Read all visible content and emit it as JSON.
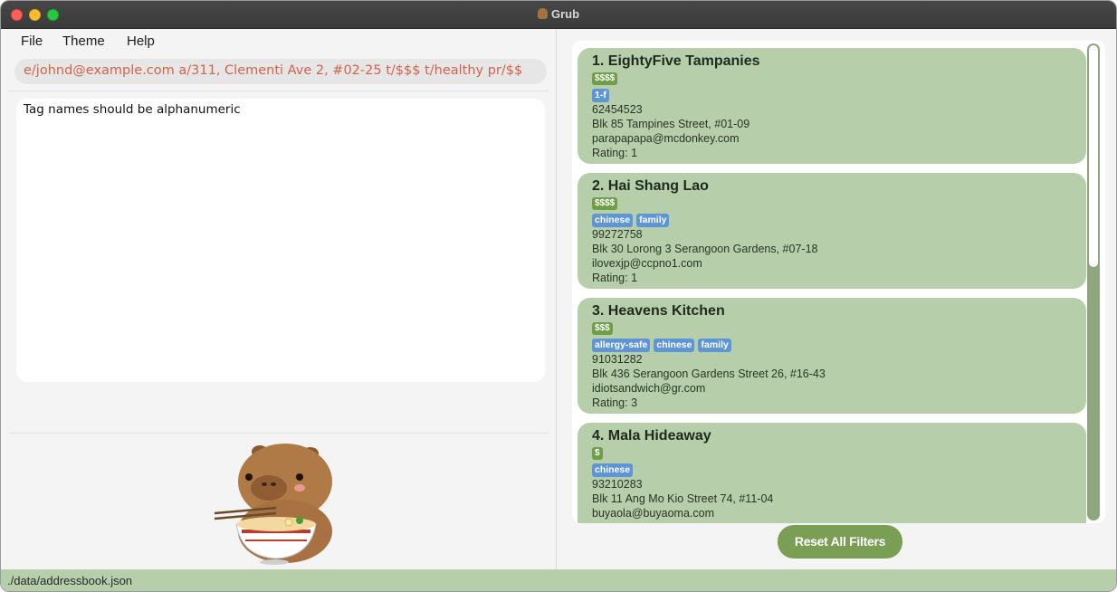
{
  "window": {
    "title": "Grub"
  },
  "menu": {
    "file": "File",
    "theme": "Theme",
    "help": "Help"
  },
  "command": {
    "value": "e/johnd@example.com a/311, Clementi Ave 2, #02-25 t/$$$ t/healthy pr/$$"
  },
  "result": {
    "message": "Tag names should be alphanumeric"
  },
  "restaurants": [
    {
      "name": "1. EightyFive Tampanies",
      "price": "$$$$",
      "tags": [
        "1-f"
      ],
      "phone": "62454523",
      "address": "Blk 85 Tampines Street, #01-09",
      "email": "parapapapa@mcdonkey.com",
      "rating": "Rating:  1"
    },
    {
      "name": "2. Hai Shang Lao",
      "price": "$$$$",
      "tags": [
        "chinese",
        "family"
      ],
      "phone": "99272758",
      "address": "Blk 30 Lorong 3 Serangoon Gardens, #07-18",
      "email": "ilovexjp@ccpno1.com",
      "rating": "Rating:  1"
    },
    {
      "name": "3. Heavens Kitchen",
      "price": "$$$",
      "tags": [
        "allergy-safe",
        "chinese",
        "family"
      ],
      "phone": "91031282",
      "address": "Blk 436 Serangoon Gardens Street 26, #16-43",
      "email": "idiotsandwich@gr.com",
      "rating": "Rating:  3"
    },
    {
      "name": "4. Mala Hideaway",
      "price": "$",
      "tags": [
        "chinese"
      ],
      "phone": "93210283",
      "address": "Blk 11 Ang Mo Kio Street 74, #11-04",
      "email": "buyaola@buyaoma.com",
      "rating": ""
    }
  ],
  "reset_button": "Reset All Filters",
  "status": {
    "path": "./data/addressbook.json"
  },
  "colors": {
    "card": "#b7ceab",
    "price_tag": "#6f9e48",
    "tag": "#5d95d6",
    "button": "#7a9e53",
    "command_text": "#d0644a"
  }
}
